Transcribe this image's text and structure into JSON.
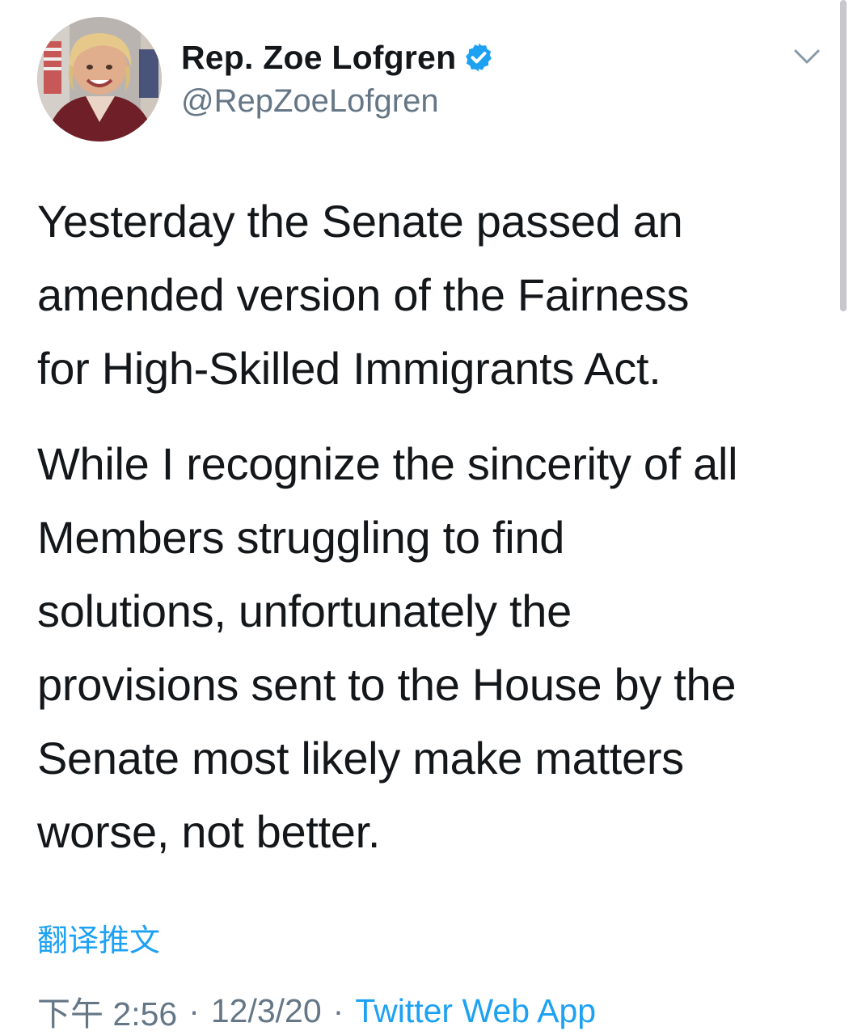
{
  "author": {
    "display_name": "Rep. Zoe Lofgren",
    "handle": "@RepZoeLofgren",
    "verified_icon": "verified-badge-icon",
    "avatar": "profile-photo"
  },
  "tweet": {
    "paragraphs": [
      "Yesterday the Senate passed an\namended version of the Fairness\nfor High-Skilled Immigrants Act.",
      "While I recognize the sincerity of all\nMembers struggling to find\nsolutions, unfortunately the\nprovisions sent to the House by the\nSenate most likely make matters\nworse, not better."
    ],
    "translate_label": "翻译推文",
    "time": "下午 2:56",
    "separator": "·",
    "date": "12/3/20",
    "source": "Twitter Web App"
  },
  "icons": {
    "menu": "chevron-down-icon"
  },
  "colors": {
    "text": "#14171a",
    "secondary": "#657786",
    "accent": "#1da1f2"
  }
}
